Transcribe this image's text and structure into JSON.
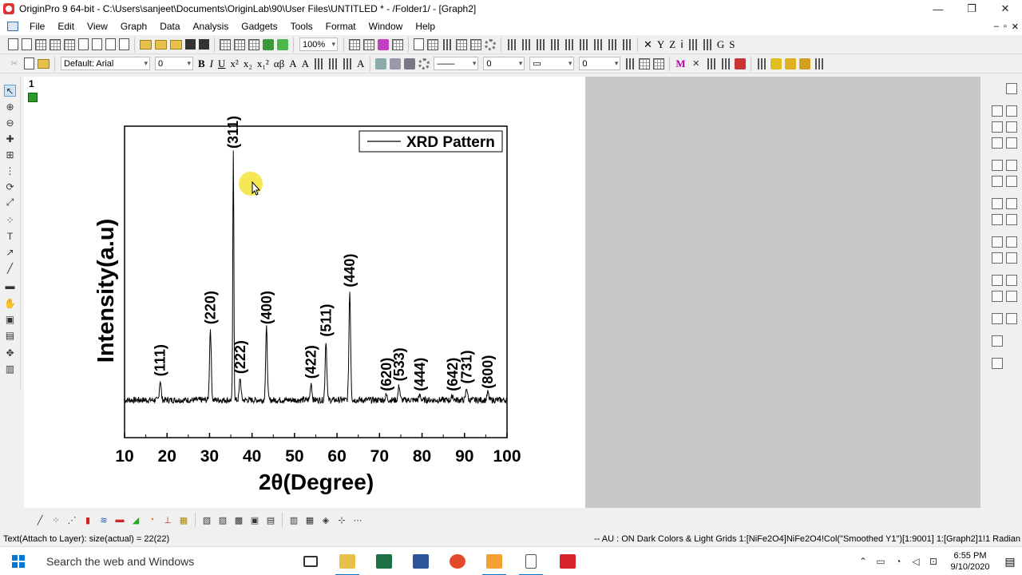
{
  "window": {
    "title": "OriginPro 9 64-bit - C:\\Users\\sanjeet\\Documents\\OriginLab\\90\\User Files\\UNTITLED * - /Folder1/ - [Graph2]",
    "controls": [
      "—",
      "❐",
      "✕"
    ]
  },
  "menu": {
    "items": [
      "File",
      "Edit",
      "View",
      "Graph",
      "Data",
      "Analysis",
      "Gadgets",
      "Tools",
      "Format",
      "Window",
      "Help"
    ],
    "mdi_controls": [
      "–",
      "▫",
      "✕"
    ]
  },
  "toolbar1": {
    "zoom": "100%"
  },
  "toolbar2": {
    "font": "Default: Arial",
    "font_size": "0",
    "line_width": "0",
    "border_width": "0"
  },
  "layer_panel": {
    "layer_number": "1"
  },
  "chart_data": {
    "type": "line",
    "xlabel": "2θ(Degree)",
    "ylabel": "Intensity(a.u)",
    "xlim": [
      10,
      100
    ],
    "xticks": [
      "10",
      "20",
      "30",
      "40",
      "50",
      "60",
      "70",
      "80",
      "90",
      "100"
    ],
    "grid": false,
    "legend": {
      "entry": "XRD Pattern",
      "position": "top-right"
    },
    "series": [
      {
        "name": "XRD Pattern",
        "peaks": [
          {
            "x": 18.4,
            "label": "(111)",
            "height": 0.08
          },
          {
            "x": 30.2,
            "label": "(220)",
            "height": 0.29
          },
          {
            "x": 35.6,
            "label": "(311)",
            "height": 1.0
          },
          {
            "x": 37.2,
            "label": "(222)",
            "height": 0.09
          },
          {
            "x": 43.4,
            "label": "(400)",
            "height": 0.29
          },
          {
            "x": 53.9,
            "label": "(422)",
            "height": 0.07
          },
          {
            "x": 57.4,
            "label": "(511)",
            "height": 0.24
          },
          {
            "x": 63.0,
            "label": "(440)",
            "height": 0.44
          },
          {
            "x": 71.6,
            "label": "(620)",
            "height": 0.02
          },
          {
            "x": 74.6,
            "label": "(533)",
            "height": 0.06
          },
          {
            "x": 79.5,
            "label": "(444)",
            "height": 0.02
          },
          {
            "x": 87.2,
            "label": "(642)",
            "height": 0.02
          },
          {
            "x": 90.5,
            "label": "(731)",
            "height": 0.05
          },
          {
            "x": 95.5,
            "label": "(800)",
            "height": 0.03
          }
        ]
      }
    ]
  },
  "status": {
    "left": "Text(Attach to Layer): size(actual) = 22(22)",
    "right": "-- AU : ON  Dark Colors & Light Grids  1:[NiFe2O4]NiFe2O4!Col(\"Smoothed Y1\")[1:9001]  1:[Graph2]1!1  Radian"
  },
  "taskbar": {
    "search_placeholder": "Search the web and Windows",
    "time": "6:55 PM",
    "date": "9/10/2020"
  },
  "colors": {
    "accent": "#0078d7",
    "cursor_highlight": "#f5e33a",
    "excel": "#1d7044",
    "word": "#2b579a",
    "acrobat": "#d8232a"
  }
}
